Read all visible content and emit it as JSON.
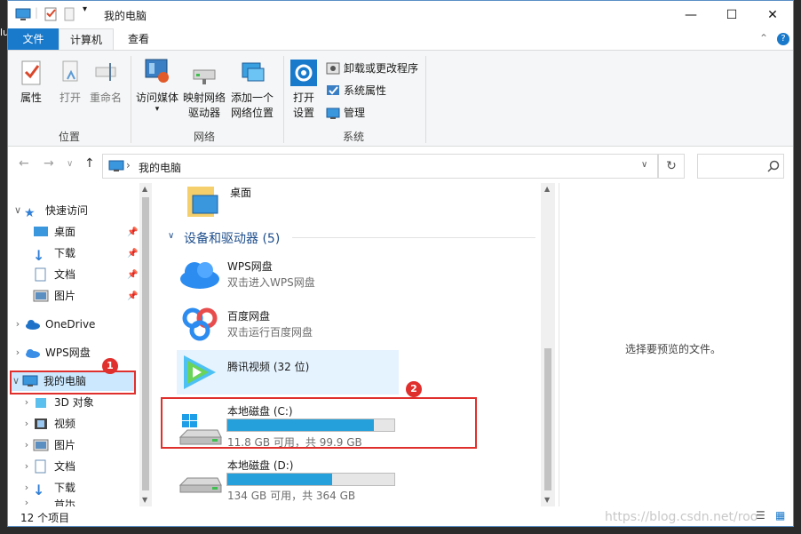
{
  "window": {
    "title": "我的电脑",
    "controls": {
      "minimize": "—",
      "maximize": "☐",
      "close": "✕"
    }
  },
  "ribbon": {
    "tabs": [
      {
        "label": "文件"
      },
      {
        "label": "计算机"
      },
      {
        "label": "查看"
      }
    ],
    "location_group": {
      "label": "位置",
      "properties": "属性",
      "open": "打开",
      "rename": "重命名"
    },
    "network_group": {
      "label": "网络",
      "access_media": "访问媒体",
      "map_drive_1": "映射网络",
      "map_drive_2": "驱动器",
      "add_location_1": "添加一个",
      "add_location_2": "网络位置"
    },
    "system_group": {
      "label": "系统",
      "open_settings_1": "打开",
      "open_settings_2": "设置",
      "uninstall": "卸载或更改程序",
      "system_properties": "系统属性",
      "manage": "管理"
    }
  },
  "address": {
    "path": "我的电脑",
    "separator": "›",
    "search_icon": "search-icon"
  },
  "nav_pane": {
    "quick_access": "快速访问",
    "quick_items": [
      {
        "label": "桌面"
      },
      {
        "label": "下载"
      },
      {
        "label": "文档"
      },
      {
        "label": "图片"
      }
    ],
    "onedrive": "OneDrive",
    "wps": "WPS网盘",
    "this_pc": "我的电脑",
    "pc_items": [
      {
        "label": "3D 对象"
      },
      {
        "label": "视频"
      },
      {
        "label": "图片"
      },
      {
        "label": "文档"
      },
      {
        "label": "下载"
      },
      {
        "label": "音乐"
      }
    ]
  },
  "content": {
    "desktop_item": "桌面",
    "group_header": "设备和驱动器 (5)",
    "items": [
      {
        "title": "WPS网盘",
        "subtitle": "双击进入WPS网盘"
      },
      {
        "title": "百度网盘",
        "subtitle": "双击运行百度网盘"
      },
      {
        "title": "腾讯视频 (32 位)"
      }
    ],
    "drives": [
      {
        "title": "本地磁盘 (C:)",
        "usage": "11.8 GB 可用，共 99.9 GB",
        "used_fraction": 0.88
      },
      {
        "title": "本地磁盘 (D:)",
        "usage": "134 GB 可用，共 364 GB",
        "used_fraction": 0.63
      }
    ]
  },
  "preview_text": "选择要预览的文件。",
  "status": {
    "count": "12 个项目"
  },
  "annotations": {
    "badge1": "1",
    "badge2": "2"
  },
  "watermark": "https://blog.csdn.net/roo",
  "colors": {
    "accent": "#1979ca",
    "drive_bar": "#26a0da",
    "highlight": "#e0302d",
    "selected": "#cce8ff"
  }
}
